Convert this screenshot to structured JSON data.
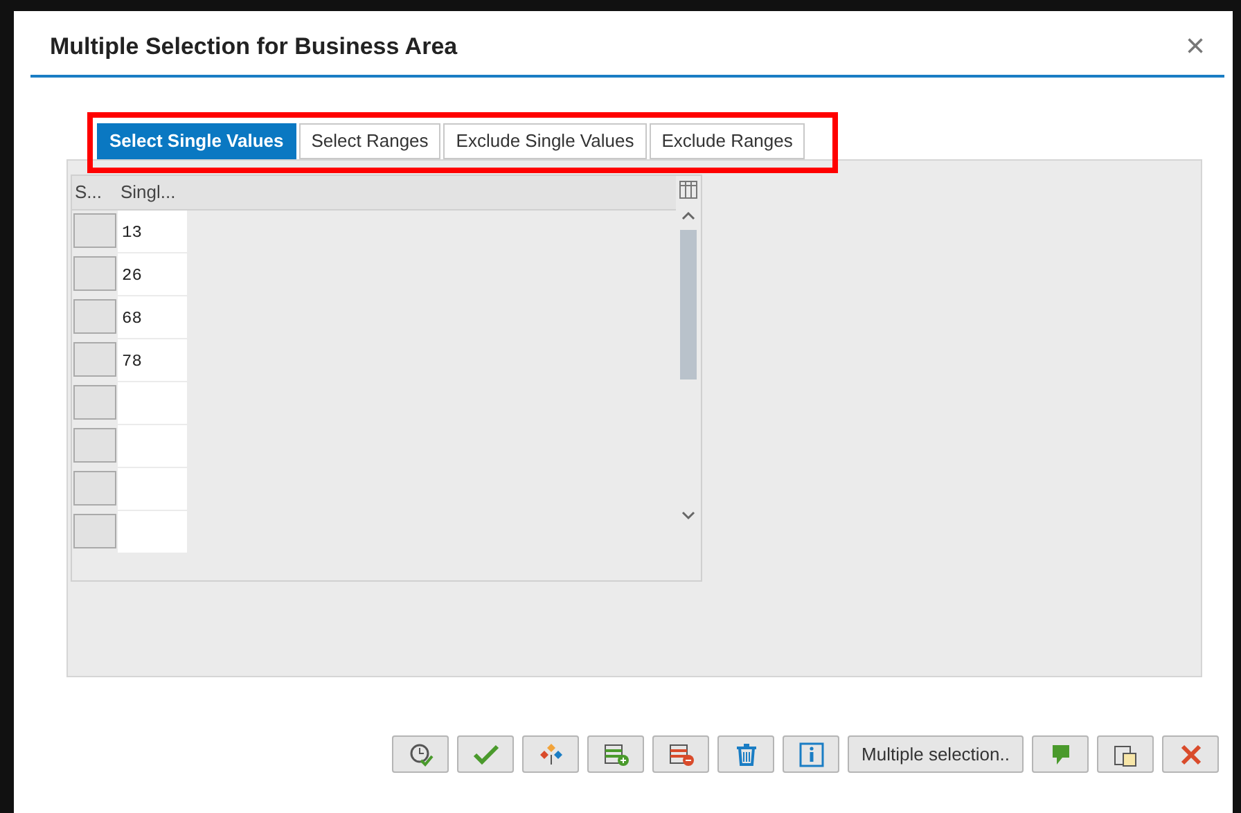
{
  "dialog": {
    "title": "Multiple Selection for Business Area",
    "close": "×"
  },
  "tabs": [
    {
      "label": "Select Single Values",
      "selected": true
    },
    {
      "label": "Select Ranges",
      "selected": false
    },
    {
      "label": "Exclude Single Values",
      "selected": false
    },
    {
      "label": "Exclude Ranges",
      "selected": false
    }
  ],
  "table": {
    "columns": [
      "S...",
      "Singl..."
    ],
    "rows": [
      {
        "value": "13"
      },
      {
        "value": "26"
      },
      {
        "value": "68"
      },
      {
        "value": "78"
      },
      {},
      {},
      {},
      {}
    ]
  },
  "toolbar": {
    "multiple_selection_button": "Multiple selection.."
  }
}
